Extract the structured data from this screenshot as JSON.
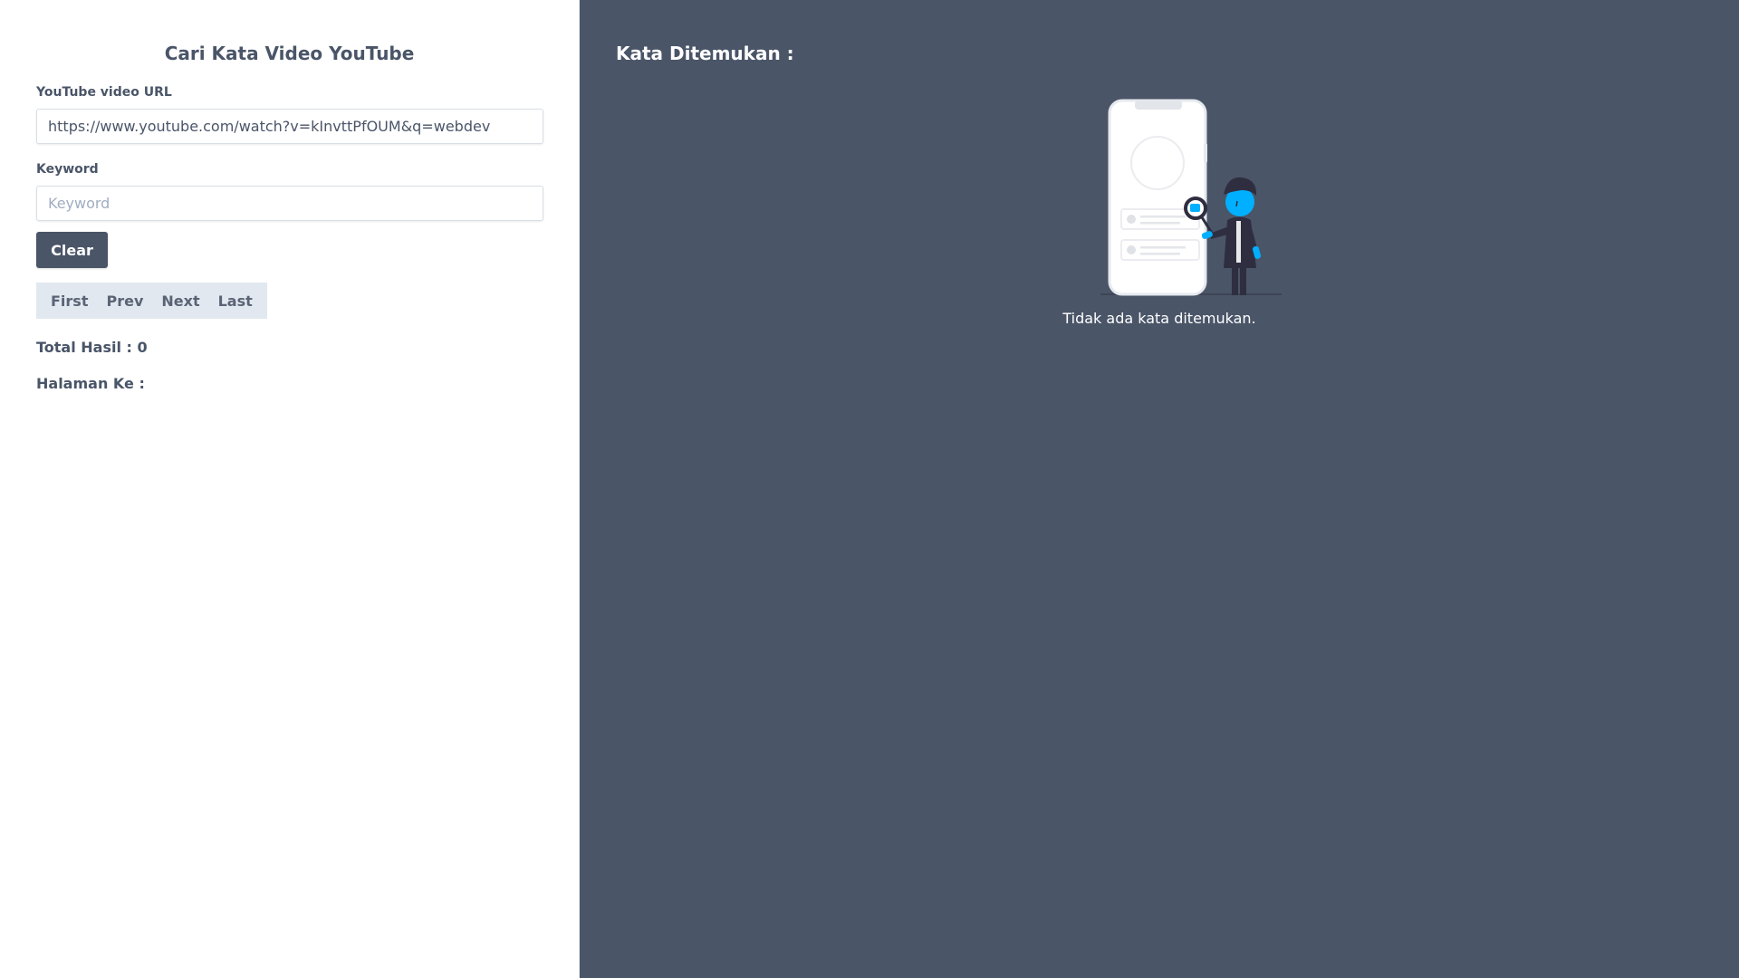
{
  "left": {
    "title": "Cari Kata Video YouTube",
    "url_label": "YouTube video URL",
    "url_value": "https://www.youtube.com/watch?v=kInvttPfOUM&q=webdev",
    "keyword_label": "Keyword",
    "keyword_placeholder": "Keyword",
    "keyword_value": "",
    "clear_label": "Clear",
    "pagination": {
      "first": "First",
      "prev": "Prev",
      "next": "Next",
      "last": "Last"
    },
    "total_label": "Total Hasil : 0",
    "page_label": "Halaman Ke :"
  },
  "right": {
    "title": "Kata Ditemukan :",
    "empty_message": "Tidak ada kata ditemukan.",
    "illustration_icon": "person-searching-phone-illustration"
  },
  "colors": {
    "panel_dark": "#4a5568",
    "accent_blue": "#00b0ff",
    "text": "#4a5568"
  }
}
